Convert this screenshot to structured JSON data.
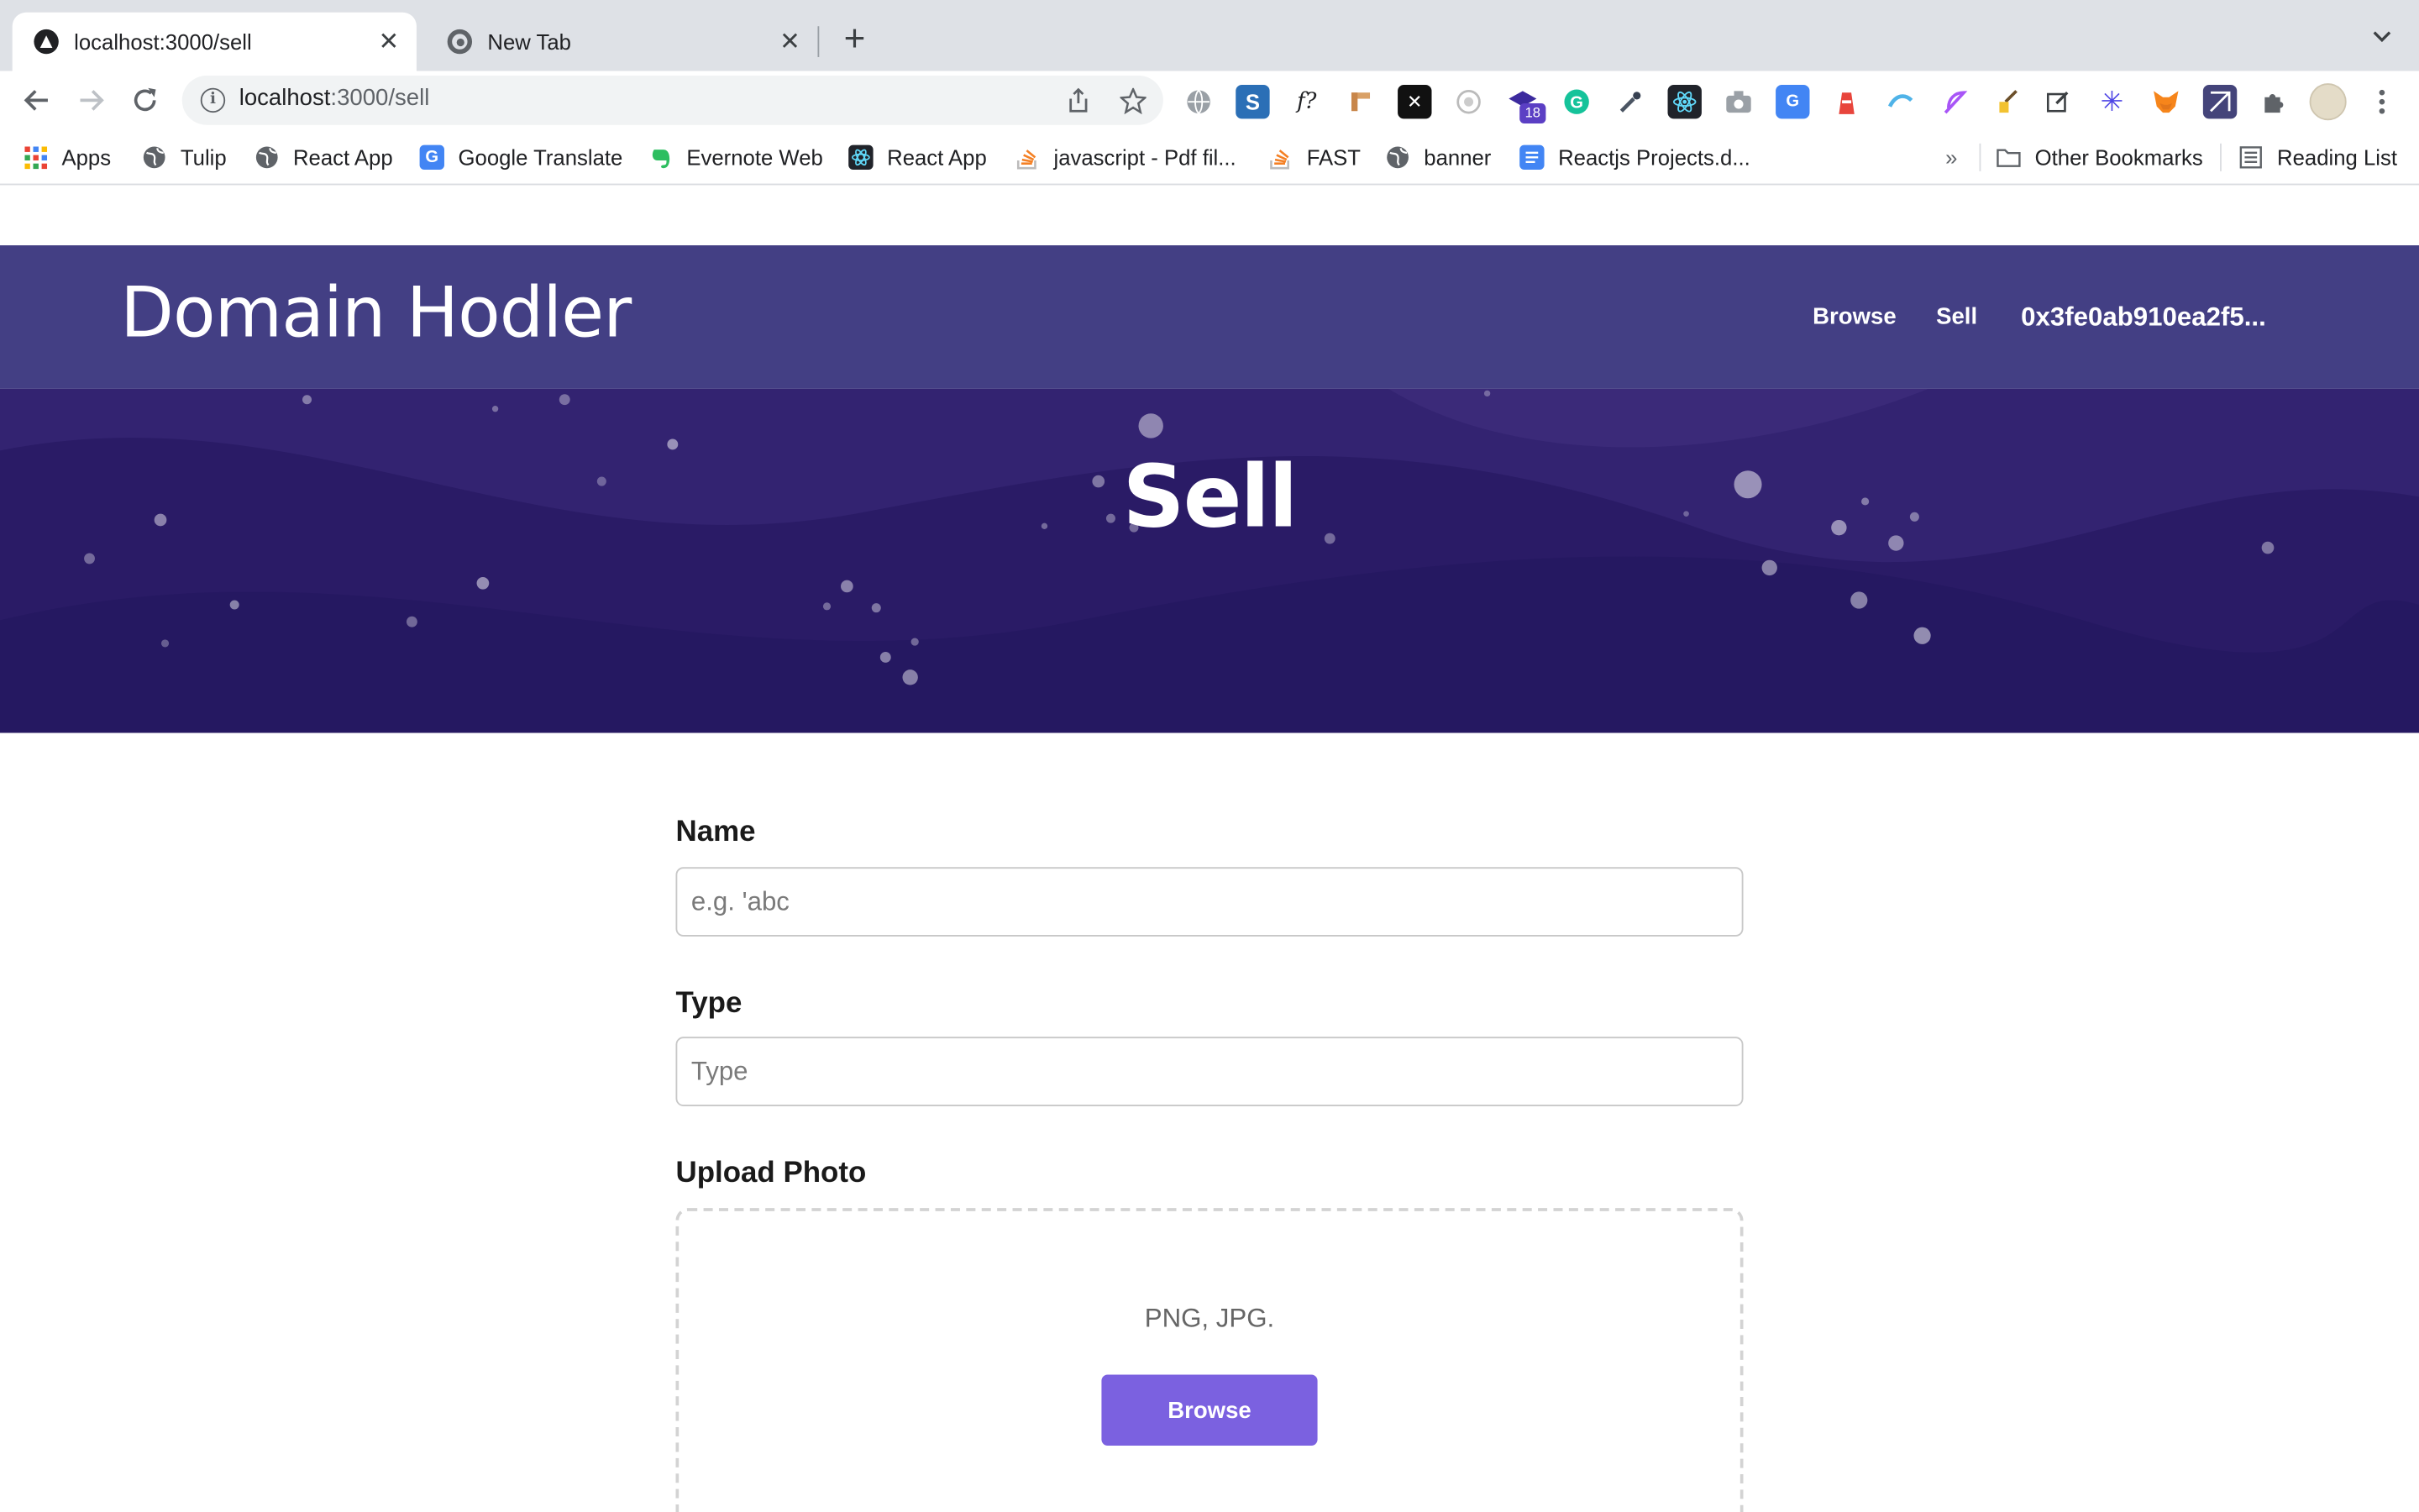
{
  "browser": {
    "tabs": [
      {
        "title": "localhost:3000/sell",
        "active": true
      },
      {
        "title": "New Tab",
        "active": false
      }
    ],
    "new_tab_symbol": "+",
    "close_symbol": "✕",
    "address": {
      "host": "localhost",
      "path": ":3000/sell"
    },
    "extension_badge": "18",
    "bookmarks": [
      {
        "label": "Apps",
        "icon": "apps-grid-icon"
      },
      {
        "label": "Tulip",
        "icon": "globe-icon"
      },
      {
        "label": "React App",
        "icon": "globe-icon"
      },
      {
        "label": "Google Translate",
        "icon": "google-translate-icon"
      },
      {
        "label": "Evernote Web",
        "icon": "evernote-icon"
      },
      {
        "label": "React App",
        "icon": "react-icon"
      },
      {
        "label": "javascript - Pdf fil...",
        "icon": "stackoverflow-icon"
      },
      {
        "label": "FAST",
        "icon": "stackoverflow-icon"
      },
      {
        "label": "banner",
        "icon": "globe-icon"
      },
      {
        "label": "Reactjs Projects.d...",
        "icon": "google-docs-icon"
      }
    ],
    "overflow_chevron": "»",
    "other_bookmarks": "Other Bookmarks",
    "reading_list": "Reading List"
  },
  "site": {
    "brand": "Domain Hodler",
    "nav": {
      "browse": "Browse",
      "sell": "Sell",
      "wallet": "0x3fe0ab910ea2f5..."
    }
  },
  "hero": {
    "title": "Sell"
  },
  "form": {
    "name_label": "Name",
    "name_placeholder": "e.g. 'abc",
    "type_label": "Type",
    "type_placeholder": "Type",
    "upload_label": "Upload Photo",
    "upload_formats": "PNG, JPG.",
    "browse_button": "Browse"
  },
  "colors": {
    "header": "#433f84",
    "hero": "#2a1b66",
    "accent_button": "#7b61e0"
  }
}
